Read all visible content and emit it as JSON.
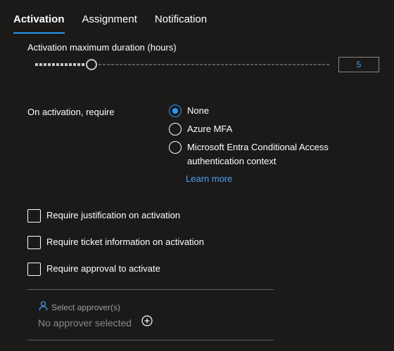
{
  "tabs": [
    {
      "label": "Activation",
      "active": true
    },
    {
      "label": "Assignment",
      "active": false
    },
    {
      "label": "Notification",
      "active": false
    }
  ],
  "activation": {
    "duration_label": "Activation maximum duration (hours)",
    "duration_value": "5",
    "slider_fraction": 0.19
  },
  "require": {
    "label": "On activation, require",
    "options": [
      {
        "label": "None",
        "checked": true
      },
      {
        "label": "Azure MFA",
        "checked": false
      },
      {
        "label": "Microsoft Entra Conditional Access authentication context",
        "checked": false
      }
    ],
    "learn_more": "Learn more"
  },
  "checkboxes": [
    {
      "label": "Require justification on activation",
      "checked": false
    },
    {
      "label": "Require ticket information on activation",
      "checked": false
    },
    {
      "label": "Require approval to activate",
      "checked": false
    }
  ],
  "approver": {
    "select_label": "Select approver(s)",
    "empty_text": "No approver selected"
  },
  "colors": {
    "accent": "#2899f5",
    "link": "#479ef5",
    "background": "#1b1a19"
  },
  "icons": {
    "person": "person-icon",
    "add": "add-circle-icon"
  }
}
